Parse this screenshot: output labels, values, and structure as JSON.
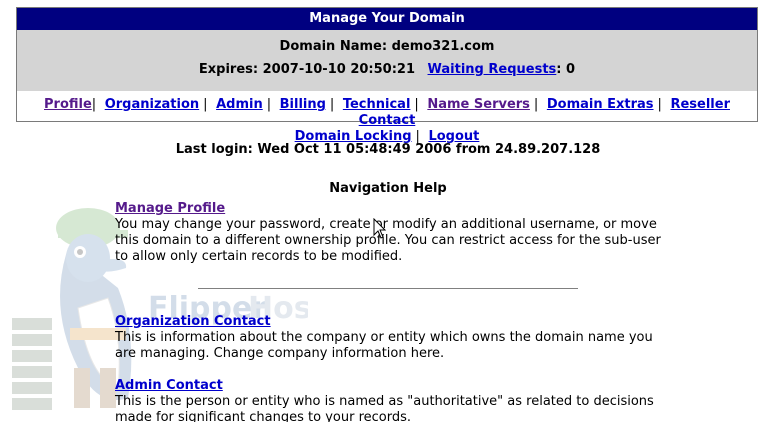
{
  "header": {
    "title": "Manage Your Domain"
  },
  "domain_info": {
    "name_label": "Domain Name:",
    "name_value": "demo321.com",
    "expires_label": "Expires:",
    "expires_value": "2007-10-10 20:50:21",
    "waiting_label": "Waiting Requests",
    "waiting_value": ": 0"
  },
  "nav": {
    "items": [
      {
        "label": "Profile"
      },
      {
        "label": "Organization"
      },
      {
        "label": "Admin"
      },
      {
        "label": "Billing"
      },
      {
        "label": "Technical"
      },
      {
        "label": "Name Servers"
      },
      {
        "label": "Domain Extras"
      },
      {
        "label": "Reseller Contact"
      },
      {
        "label": "Domain Locking"
      },
      {
        "label": "Logout"
      }
    ],
    "separator": "|"
  },
  "last_login": "Last login: Wed Oct 11 05:48:49 2006 from 24.89.207.128",
  "navigation_help": {
    "title": "Navigation Help",
    "sections": [
      {
        "link": "Manage Profile",
        "text": "You may change your password, create or modify an additional username, or move this domain to a different ownership profile. You can restrict access for the sub-user to allow only certain records to be modified."
      },
      {
        "link": "Organization Contact",
        "text": "This is information about the company or entity which owns the domain name you are managing. Change company information here."
      },
      {
        "link": "Admin Contact",
        "text": "This is the person or entity who is named as \"authoritative\" as related to decisions made for significant changes to your records."
      }
    ]
  },
  "watermark": {
    "logo_text": "FlipperHost",
    "icon": "dolphin-mascot-icon"
  },
  "colors": {
    "header_bg": "#000080",
    "info_bg": "#d4d4d4",
    "link": "#0000cc",
    "visited_link": "#551a8b"
  }
}
